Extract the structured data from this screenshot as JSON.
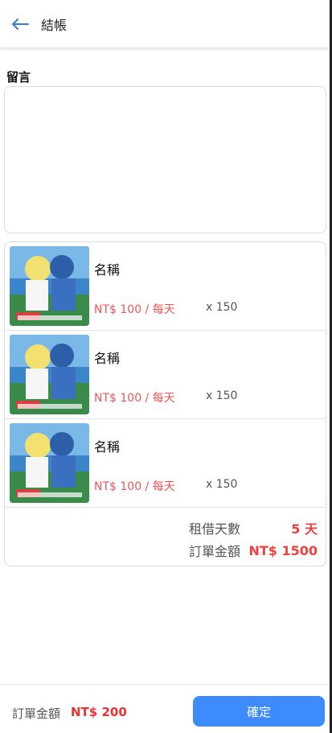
{
  "header": {
    "title": "結帳",
    "back_icon": "arrow-left-icon"
  },
  "message": {
    "label": "留言",
    "value": "",
    "placeholder": ""
  },
  "items": [
    {
      "name": "名稱",
      "price": "NT$ 100 / 每天",
      "qty": "x 150"
    },
    {
      "name": "名稱",
      "price": "NT$ 100 / 每天",
      "qty": "x 150"
    },
    {
      "name": "名稱",
      "price": "NT$ 100 / 每天",
      "qty": "x 150"
    }
  ],
  "summary": {
    "days_label": "租借天數",
    "days_value": "5 天",
    "total_label": "訂單金額",
    "total_value": "NT$ 1500"
  },
  "footer": {
    "amount_label": "訂單金額",
    "amount_value": "NT$ 200",
    "confirm_label": "確定"
  },
  "colors": {
    "accent": "#3d8bfd",
    "price": "#f05555",
    "total": "#f04040"
  }
}
